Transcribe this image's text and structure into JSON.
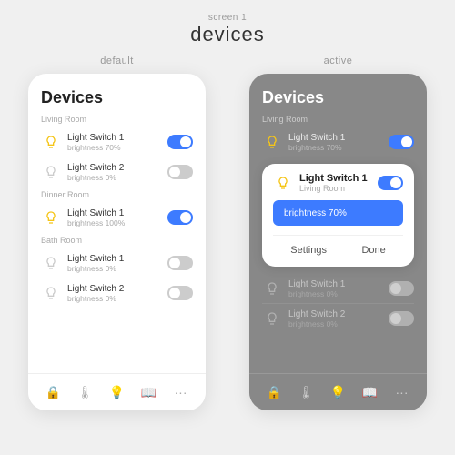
{
  "header": {
    "subtitle": "screen 1",
    "title": "devices"
  },
  "default_screen": {
    "label": "default",
    "title": "Devices",
    "sections": [
      {
        "name": "Living Room",
        "devices": [
          {
            "id": "lr1",
            "name": "Light Switch 1",
            "brightness": "brightness 70%",
            "on": true
          },
          {
            "id": "lr2",
            "name": "Light Switch 2",
            "brightness": "brightness 0%",
            "on": false
          }
        ]
      },
      {
        "name": "Dinner Room",
        "devices": [
          {
            "id": "dr1",
            "name": "Light Switch 1",
            "brightness": "brightness 100%",
            "on": true
          }
        ]
      },
      {
        "name": "Bath Room",
        "devices": [
          {
            "id": "br1",
            "name": "Light Switch 1",
            "brightness": "brightness 0%",
            "on": false
          },
          {
            "id": "br2",
            "name": "Light Switch 2",
            "brightness": "brightness 0%",
            "on": false
          }
        ]
      }
    ],
    "nav": [
      "🔒",
      "🌡",
      "💡",
      "📖",
      "···"
    ]
  },
  "active_screen": {
    "label": "active",
    "title": "Devices",
    "section_top": "Living Room",
    "top_device": {
      "name": "Light Switch 1",
      "brightness": "brightness 70%",
      "on": true
    },
    "popup": {
      "device_name": "Light Switch 1",
      "location": "Living Room",
      "brightness_label": "brightness 70%",
      "settings_btn": "Settings",
      "done_btn": "Done"
    },
    "bottom_devices": [
      {
        "id": "ab1",
        "name": "Light Switch 1",
        "brightness": "brightness 0%",
        "on": false
      },
      {
        "id": "ab2",
        "name": "Light Switch 2",
        "brightness": "brightness 0%",
        "on": false
      }
    ],
    "nav": [
      "🔒",
      "🌡",
      "💡",
      "📖",
      "···"
    ]
  }
}
